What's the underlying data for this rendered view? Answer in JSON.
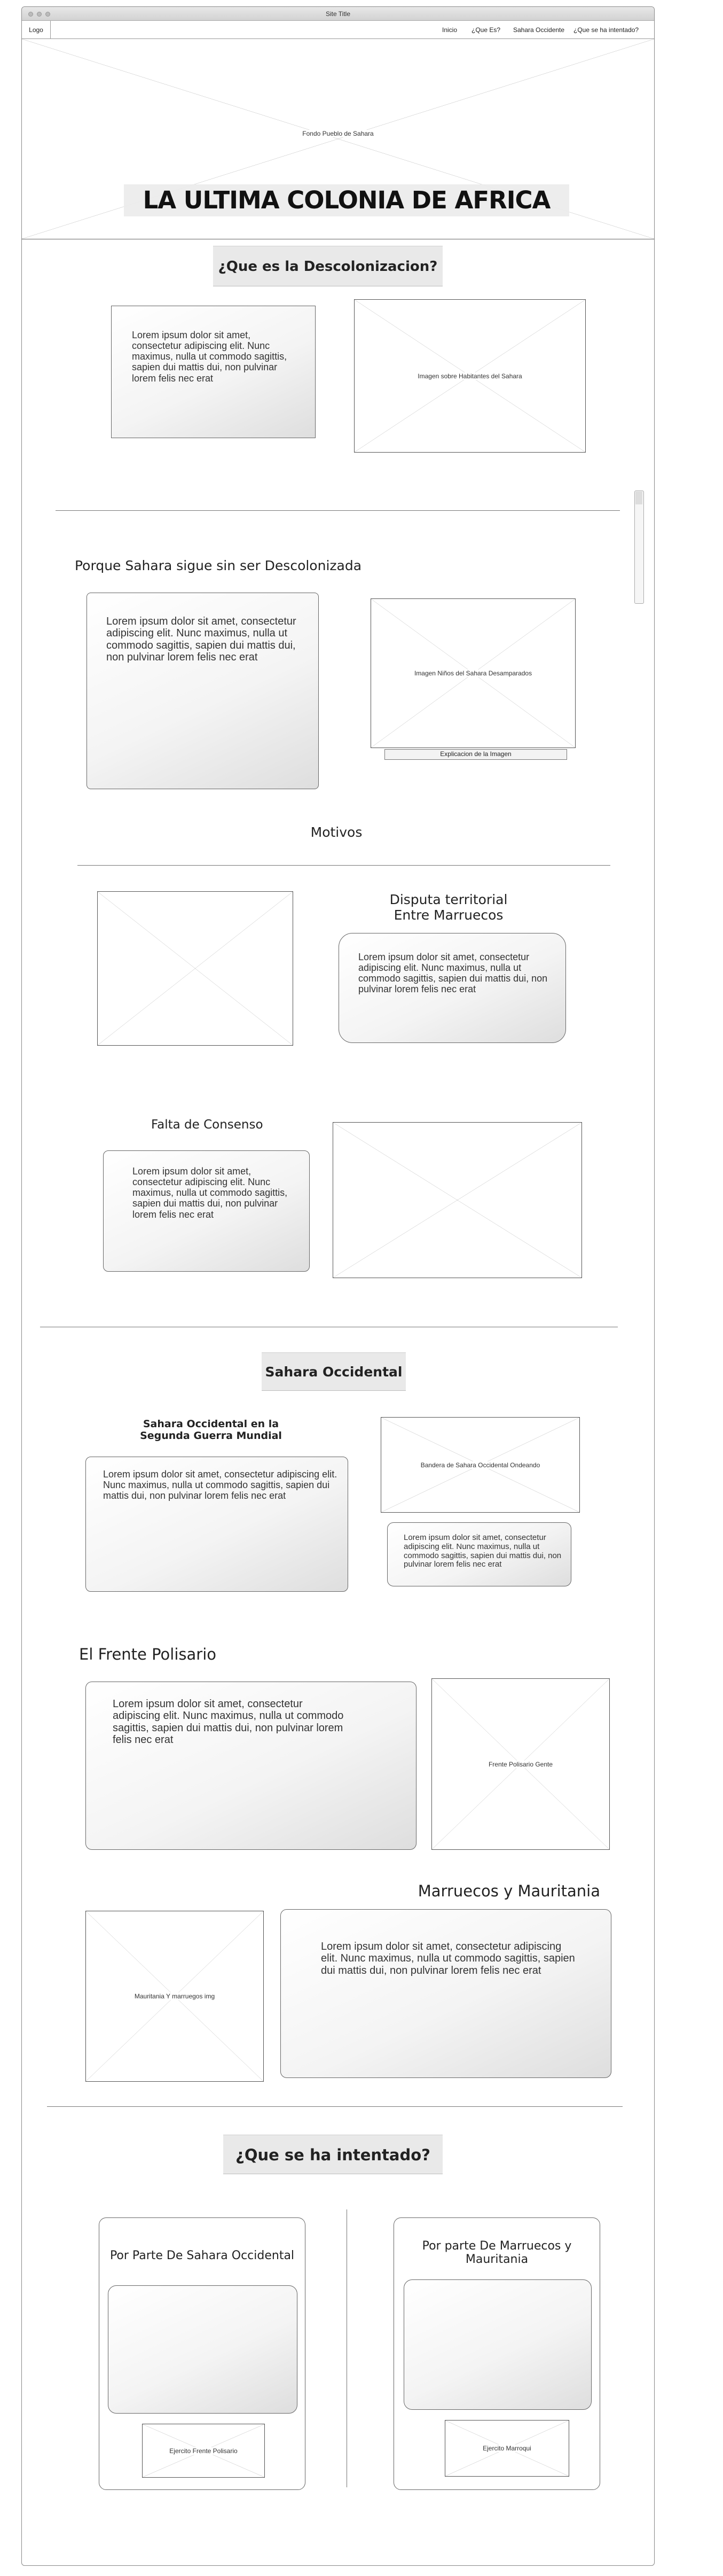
{
  "window": {
    "title": "Site Title"
  },
  "nav": {
    "logo": "Logo",
    "items": [
      "Inicio",
      "¿Que Es?",
      "Sahara Occidente",
      "¿Que se ha intentado?"
    ]
  },
  "hero": {
    "image_label": "Fondo Pueblo de Sahara",
    "title": "LA ULTIMA COLONIA DE AFRICA"
  },
  "s1": {
    "title": "¿Que es la Descolonizacion?",
    "text": "Lorem ipsum dolor sit amet, consectetur adipiscing elit. Nunc maximus, nulla ut commodo sagittis, sapien dui mattis dui, non pulvinar lorem felis nec erat",
    "image_label": "Imagen sobre Habitantes del Sahara"
  },
  "s2": {
    "title": "Porque Sahara sigue sin ser Descolonizada",
    "text": "Lorem ipsum dolor sit amet, consectetur adipiscing elit. Nunc maximus, nulla ut commodo sagittis, sapien dui mattis dui, non pulvinar lorem felis nec erat",
    "image_label": "Imagen Niños del Sahara Desamparados",
    "caption": "Explicacion de la Imagen",
    "motivos": "Motivos",
    "disputa_title": "Disputa territorial\nEntre Marruecos",
    "disputa_text": "Lorem ipsum dolor sit amet, consectetur adipiscing elit. Nunc maximus, nulla ut commodo sagittis, sapien dui mattis dui, non pulvinar lorem felis nec erat",
    "consenso_title": "Falta de Consenso",
    "consenso_text": "Lorem ipsum dolor sit amet, consectetur adipiscing elit. Nunc maximus, nulla ut commodo sagittis, sapien dui mattis dui, non pulvinar lorem felis nec erat"
  },
  "s3": {
    "title": "Sahara Occidental",
    "sub_title": "Sahara Occidental en la\nSegunda Guerra Mundial",
    "text1": "Lorem ipsum dolor sit amet, consectetur adipiscing elit. Nunc maximus, nulla ut commodo sagittis, sapien dui mattis dui, non pulvinar lorem felis nec erat",
    "flag_label": "Bandera de Sahara Occidental Ondeando",
    "text2": "Lorem ipsum dolor sit amet, consectetur adipiscing elit. Nunc maximus, nulla ut commodo sagittis, sapien dui mattis dui, non pulvinar lorem felis nec erat",
    "polisario_title": "El Frente Polisario",
    "polisario_text": "Lorem ipsum dolor sit amet, consectetur adipiscing elit. Nunc maximus, nulla ut commodo sagittis, sapien dui mattis dui, non pulvinar lorem felis nec erat",
    "polisario_img": "Frente Polisario Gente",
    "mm_title": "Marruecos y Mauritania",
    "mm_img": "Mauritania Y marruegos img",
    "mm_text": "Lorem ipsum dolor sit amet, consectetur adipiscing elit. Nunc maximus, nulla ut commodo sagittis, sapien dui mattis dui, non pulvinar lorem felis nec erat"
  },
  "s4": {
    "title": "¿Que se ha intentado?",
    "left_title": "Por Parte De Sahara Occidental",
    "left_img": "Ejercito Frente Polisario",
    "right_title": "Por parte De Marruecos y\nMauritania",
    "right_img": "Ejercito Marroqui"
  }
}
